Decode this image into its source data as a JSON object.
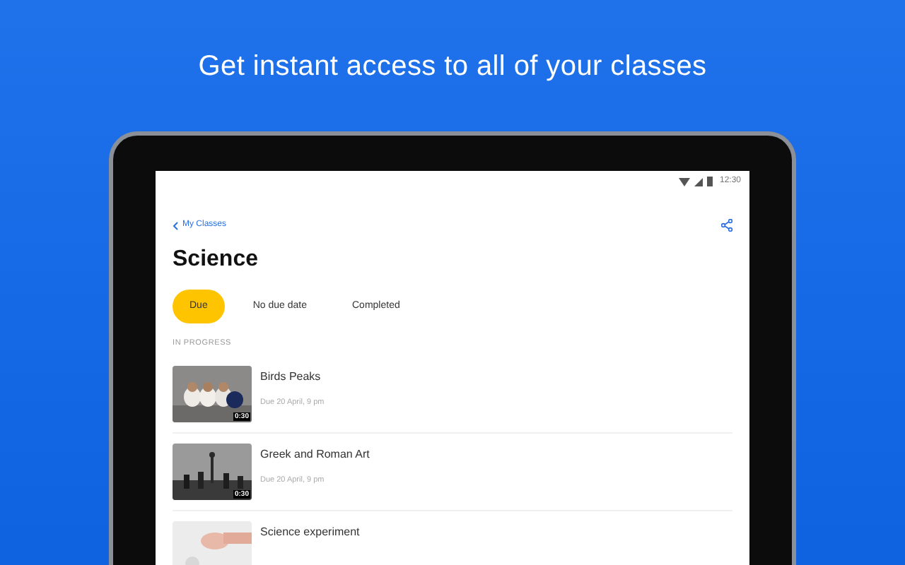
{
  "headline": "Get instant access to all of your classes",
  "status_bar": {
    "time": "12:30"
  },
  "back_link": "My Classes",
  "title": "Science",
  "tabs": [
    {
      "label": "Due",
      "selected": true
    },
    {
      "label": "No due date",
      "selected": false
    },
    {
      "label": "Completed",
      "selected": false
    }
  ],
  "section": "IN PROGRESS",
  "items": [
    {
      "title": "Birds Peaks",
      "due": "Due 20 April, 9 pm",
      "duration": "0:30",
      "kind": "birds"
    },
    {
      "title": "Greek and Roman Art",
      "due": "Due 20 April, 9 pm",
      "duration": "0:30",
      "kind": "art"
    },
    {
      "title": "Science experiment",
      "kind": "hand"
    }
  ]
}
